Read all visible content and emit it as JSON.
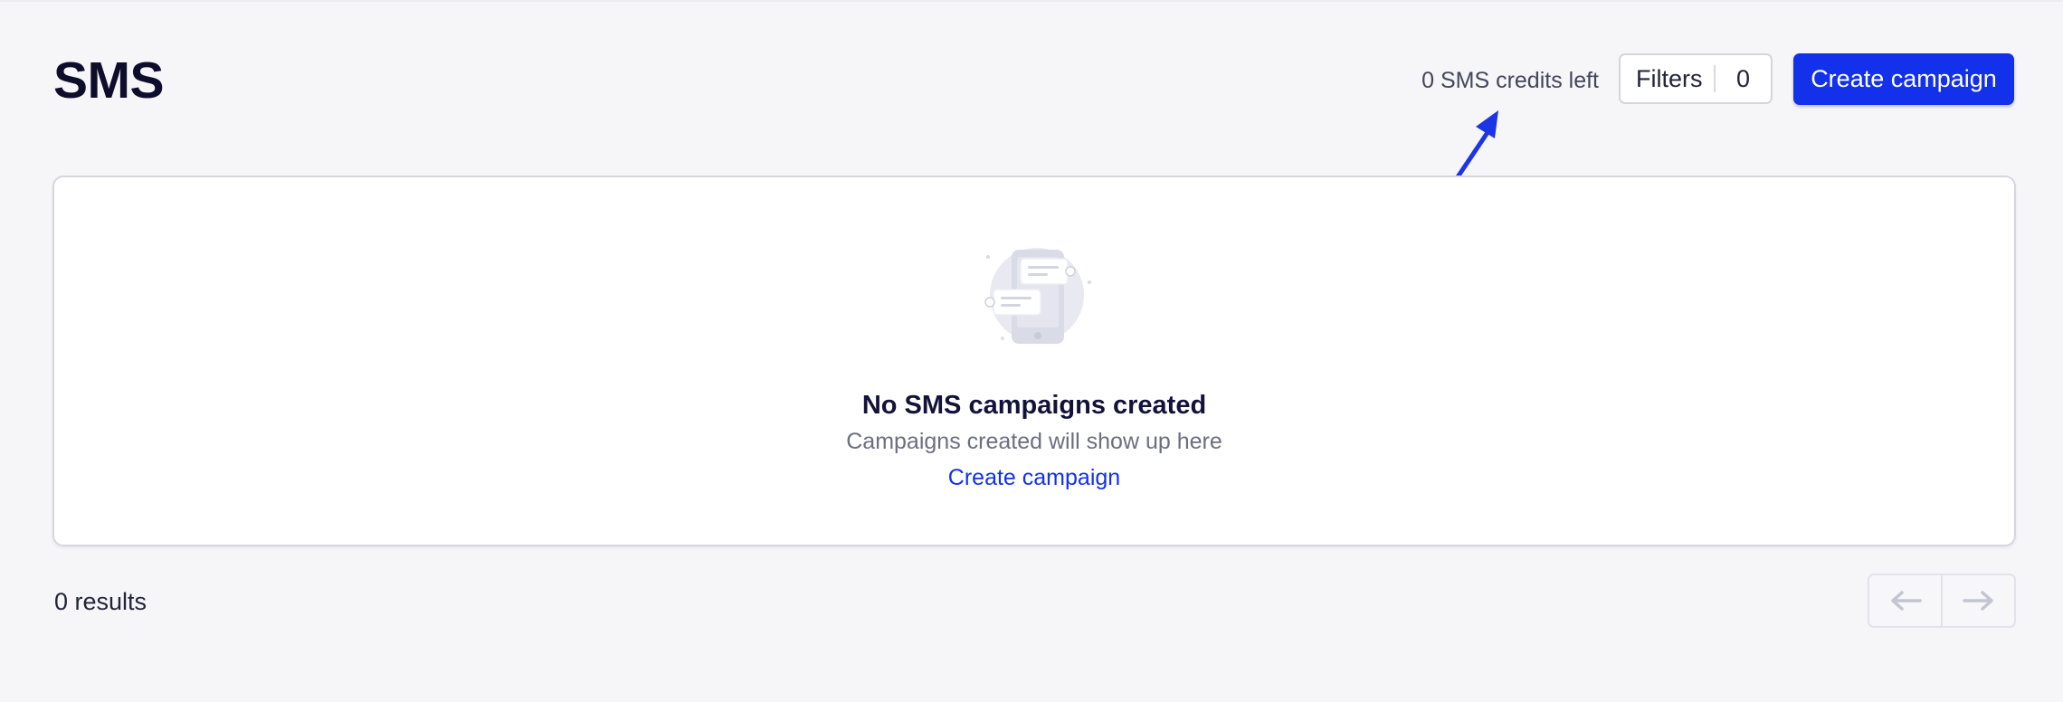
{
  "header": {
    "title": "SMS",
    "credits_text": "0 SMS credits left",
    "filters": {
      "label": "Filters",
      "count": "0"
    },
    "create_button_label": "Create campaign"
  },
  "empty_state": {
    "icon": "sms-phone-illustration",
    "title": "No SMS campaigns created",
    "subtitle": "Campaigns created will show up here",
    "link_label": "Create campaign"
  },
  "footer": {
    "results_text": "0 results",
    "pagination": {
      "prev_icon": "arrow-left-icon",
      "next_icon": "arrow-right-icon"
    }
  },
  "annotation": {
    "type": "arrow",
    "color": "#1c35e6",
    "points_to": "credits_text"
  },
  "colors": {
    "accent": "#1330ea",
    "background": "#f6f6f9",
    "panel": "#ffffff"
  }
}
